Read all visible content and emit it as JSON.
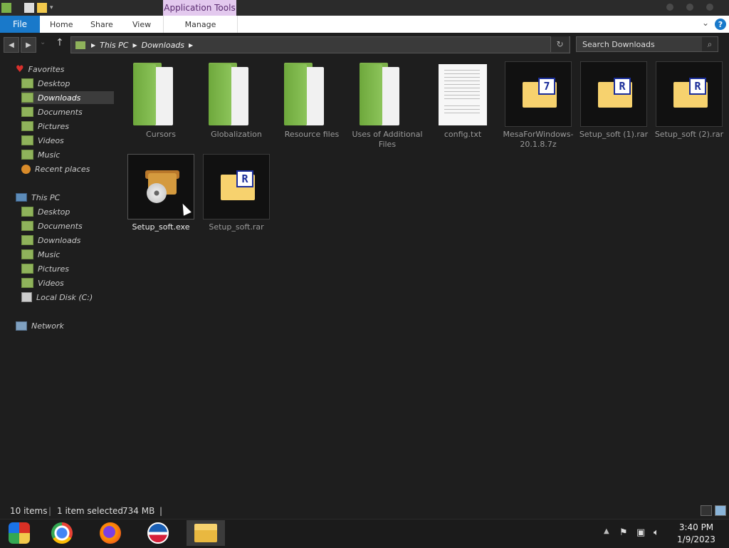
{
  "title_bar": {
    "context_tab": "Application Tools"
  },
  "ribbon": {
    "file": "File",
    "tabs": [
      "Home",
      "Share",
      "View"
    ],
    "manage": "Manage",
    "help": "?"
  },
  "address": {
    "crumbs": [
      "This PC",
      "Downloads"
    ],
    "search_placeholder": "Search Downloads"
  },
  "nav": {
    "favorites": {
      "label": "Favorites",
      "items": [
        "Desktop",
        "Downloads",
        "Documents",
        "Pictures",
        "Videos",
        "Music",
        "Recent places"
      ],
      "selected": "Downloads"
    },
    "this_pc": {
      "label": "This PC",
      "items": [
        "Desktop",
        "Documents",
        "Downloads",
        "Music",
        "Pictures",
        "Videos",
        "Local Disk (C:)"
      ]
    },
    "network": {
      "label": "Network"
    }
  },
  "files": [
    {
      "name": "Cursors",
      "type": "folder"
    },
    {
      "name": "Globalization",
      "type": "folder"
    },
    {
      "name": "Resource files",
      "type": "folder"
    },
    {
      "name": "Uses of Additional Files",
      "type": "folder"
    },
    {
      "name": "config.txt",
      "type": "text"
    },
    {
      "name": "MesaForWindows-20.1.8.7z",
      "type": "archive-7z",
      "badge": "7"
    },
    {
      "name": "Setup_soft (1).rar",
      "type": "archive-rar",
      "badge": "R"
    },
    {
      "name": "Setup_soft (2).rar",
      "type": "archive-rar",
      "badge": "R"
    },
    {
      "name": "Setup_soft.exe",
      "type": "installer",
      "selected": true
    },
    {
      "name": "Setup_soft.rar",
      "type": "archive-rar",
      "badge": "R"
    }
  ],
  "status": {
    "count": "10 items",
    "selection": "1 item selected",
    "size": "734 MB"
  },
  "taskbar": {
    "apps": [
      "control-panel-icon",
      "chrome-icon",
      "firefox-icon",
      "obama-logo-icon",
      "file-explorer-icon"
    ],
    "active": "file-explorer-icon"
  },
  "clock": {
    "time": "3:40 PM",
    "date": "1/9/2023"
  },
  "colors": {
    "accent": "#1979ca",
    "context_tab": "#e3c9ee",
    "folder_green": "#7cb049",
    "rar_badge": "#1b2e9a"
  }
}
